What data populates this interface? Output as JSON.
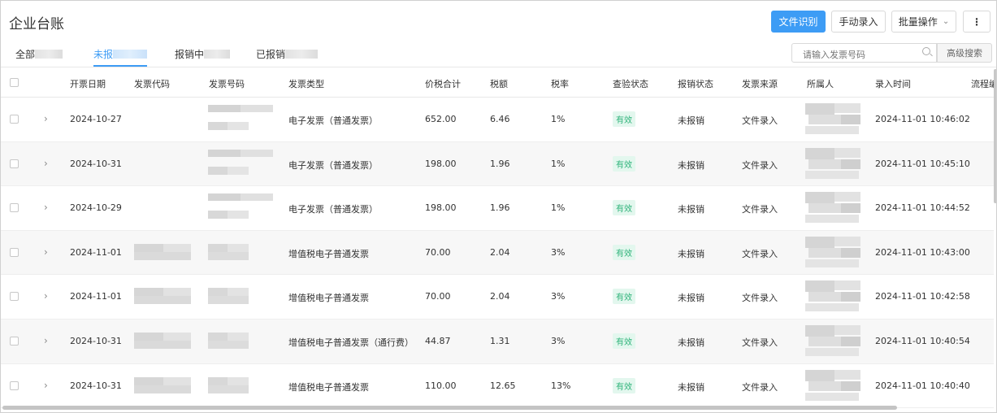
{
  "header": {
    "title": "企业台账",
    "ocr_button": "文件识别",
    "manual_button": "手动录入",
    "batch_button": "批量操作",
    "more_button": "⋮"
  },
  "tabs": [
    {
      "label": "全部",
      "active": false
    },
    {
      "label": "未报",
      "active": true
    },
    {
      "label": "报销中",
      "active": false
    },
    {
      "label": "已报销",
      "active": false
    }
  ],
  "search": {
    "placeholder": "请输入发票号码",
    "advanced_button": "高级搜索"
  },
  "columns": [
    "开票日期",
    "发票代码",
    "发票号码",
    "发票类型",
    "价税合计",
    "税额",
    "税率",
    "查验状态",
    "报销状态",
    "发票来源",
    "所属人",
    "录入时间",
    "流程编"
  ],
  "rows": [
    {
      "date": "2024-10-27",
      "type": "电子发票（普通发票）",
      "total": "652.00",
      "tax": "6.46",
      "rate": "1%",
      "check": "有效",
      "reimburse": "未报销",
      "source": "文件录入",
      "time": "2024-11-01 10:46:02"
    },
    {
      "date": "2024-10-31",
      "type": "电子发票（普通发票）",
      "total": "198.00",
      "tax": "1.96",
      "rate": "1%",
      "check": "有效",
      "reimburse": "未报销",
      "source": "文件录入",
      "time": "2024-11-01 10:45:10"
    },
    {
      "date": "2024-10-29",
      "type": "电子发票（普通发票）",
      "total": "198.00",
      "tax": "1.96",
      "rate": "1%",
      "check": "有效",
      "reimburse": "未报销",
      "source": "文件录入",
      "time": "2024-11-01 10:44:52"
    },
    {
      "date": "2024-11-01",
      "type": "增值税电子普通发票",
      "total": "70.00",
      "tax": "2.04",
      "rate": "3%",
      "check": "有效",
      "reimburse": "未报销",
      "source": "文件录入",
      "time": "2024-11-01 10:43:00"
    },
    {
      "date": "2024-11-01",
      "type": "增值税电子普通发票",
      "total": "70.00",
      "tax": "2.04",
      "rate": "3%",
      "check": "有效",
      "reimburse": "未报销",
      "source": "文件录入",
      "time": "2024-11-01 10:42:58"
    },
    {
      "date": "2024-10-31",
      "type": "增值税电子普通发票（通行费）",
      "total": "44.87",
      "tax": "1.31",
      "rate": "3%",
      "check": "有效",
      "reimburse": "未报销",
      "source": "文件录入",
      "time": "2024-11-01 10:40:54"
    },
    {
      "date": "2024-10-31",
      "type": "增值税电子普通发票",
      "total": "110.00",
      "tax": "12.65",
      "rate": "13%",
      "check": "有效",
      "reimburse": "未报销",
      "source": "文件录入",
      "time": "2024-11-01 10:40:40"
    }
  ],
  "colors": {
    "primary": "#3d9cf5",
    "valid_bg": "#e3f7ee",
    "valid_text": "#2fb37a"
  }
}
